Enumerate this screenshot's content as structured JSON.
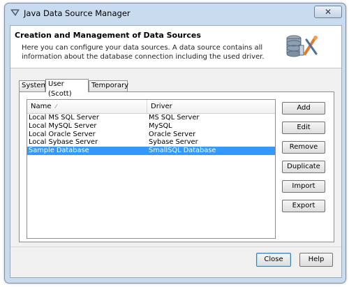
{
  "window": {
    "title": "Java Data Source Manager",
    "close_glyph": "✕"
  },
  "header": {
    "title": "Creation and Management of Data Sources",
    "description": "Here you can configure your data sources. A data source contains all information about the database connection including the used driver.",
    "icon": "database-tools-icon"
  },
  "tabs": [
    {
      "label": "System",
      "active": false
    },
    {
      "label": "User (Scott)",
      "active": true
    },
    {
      "label": "Temporary",
      "active": false
    }
  ],
  "table": {
    "columns": [
      "Name",
      "Driver"
    ],
    "sort_indicator": "⁄",
    "rows": [
      {
        "name": "Local MS SQL Server",
        "driver": "MS SQL Server",
        "selected": false
      },
      {
        "name": "Local MySQL Server",
        "driver": "MySQL",
        "selected": false
      },
      {
        "name": "Local Oracle Server",
        "driver": "Oracle Server",
        "selected": false
      },
      {
        "name": "Local Sybase Server",
        "driver": "Sybase Server",
        "selected": false
      },
      {
        "name": "Sample Database",
        "driver": "SmallSQL Database",
        "selected": true
      }
    ]
  },
  "actions": {
    "add": "Add",
    "edit": "Edit",
    "remove": "Remove",
    "duplicate": "Duplicate",
    "import": "Import",
    "export": "Export"
  },
  "footer": {
    "close": "Close",
    "help": "Help"
  },
  "colors": {
    "selection": "#3399ff",
    "frame": "#c9dbee"
  }
}
